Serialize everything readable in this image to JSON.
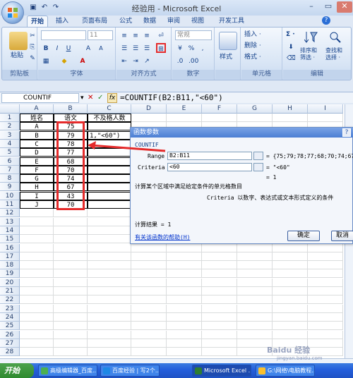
{
  "window": {
    "title": "经验用 - Microsoft Excel",
    "controls": [
      "–",
      "▭",
      "✕"
    ]
  },
  "ribbon_tabs": [
    "开始",
    "插入",
    "页面布局",
    "公式",
    "数据",
    "审阅",
    "视图",
    "开发工具"
  ],
  "ribbon": {
    "clipboard": {
      "paste_label": "粘贴",
      "group_label": "剪贴板"
    },
    "font": {
      "font_size_box": "11",
      "bold": "B",
      "italic": "I",
      "underline": "U",
      "grow": "A",
      "shrink": "A",
      "group_label": "字体"
    },
    "alignment": {
      "group_label": "对齐方式"
    },
    "number": {
      "format_box": "常规",
      "percent": "%",
      "comma": ",",
      "group_label": "数字"
    },
    "styles": {
      "label": "样式"
    },
    "cells": {
      "insert": "插入 ·",
      "delete": "删除 ·",
      "format": "格式 ·",
      "group_label": "单元格"
    },
    "editing": {
      "sum": "Σ ·",
      "sort_label": "排序和\n筛选 ·",
      "find_label": "查找和\n选择 ·",
      "group_label": "编辑"
    }
  },
  "formula_bar": {
    "name_box": "COUNTIF",
    "fx": "fx",
    "formula": "=COUNTIF(B2:B11,\"<60\")"
  },
  "sheet": {
    "columns": [
      "A",
      "B",
      "C",
      "D",
      "E",
      "F",
      "G",
      "H",
      "I"
    ],
    "rows": [
      "1",
      "2",
      "3",
      "4",
      "5",
      "6",
      "7",
      "8",
      "9",
      "10",
      "11",
      "12",
      "13",
      "14",
      "15",
      "16",
      "17",
      "18",
      "19",
      "20",
      "21",
      "22",
      "23",
      "24",
      "25",
      "26",
      "27",
      "28"
    ],
    "header": {
      "A": "姓名",
      "B": "语文",
      "C": "不及格人数"
    },
    "names": [
      "A",
      "B",
      "C",
      "D",
      "E",
      "F",
      "G",
      "H",
      "I",
      "J"
    ],
    "scores": [
      "75",
      "79",
      "78",
      "77",
      "68",
      "70",
      "74",
      "67",
      "43",
      "70"
    ],
    "c3_edit": "1,\"<60\")"
  },
  "dialog": {
    "title": "函数参数",
    "help_btn": "?",
    "function_name": "COUNTIF",
    "range_label": "Range",
    "range_value": "B2:B11",
    "range_result": "= {75;79;78;77;68;70;74;67;43",
    "criteria_label": "Criteria",
    "criteria_value": "<60",
    "criteria_result": "= \"<60\"",
    "total_result": "= 1",
    "description": "计算某个区域中满足给定条件的单元格数目",
    "param_desc": "Criteria  以数字、表达式或文本形式定义的条件",
    "calc_result": "计算结果 = 1",
    "help_link": "有关该函数的帮助(H)",
    "ok": "确定",
    "cancel": "取消"
  },
  "taskbar": {
    "start": "开始",
    "tasks": [
      "高级编辑器_百度...",
      "百度经验 | 写2个...",
      "Microsoft Excel ...",
      "G:\\网络\\电脑教程..."
    ]
  },
  "watermark": {
    "text": "Baidu 经验",
    "url": "jingyan.baidu.com"
  },
  "colors": {
    "highlight": "#e52b2b",
    "ribbon": "#dfe8f5",
    "taskbar": "#245edb"
  }
}
